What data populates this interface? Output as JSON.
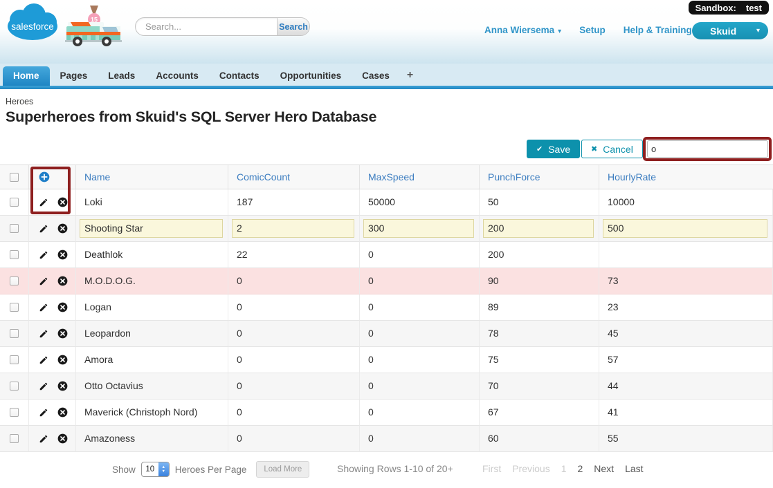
{
  "sandbox": {
    "label": "Sandbox:",
    "value": "test"
  },
  "header": {
    "logo_text": "salesforce",
    "search": {
      "placeholder": "Search...",
      "button": "Search"
    },
    "user": "Anna Wiersema",
    "links": {
      "setup": "Setup",
      "help": "Help & Training"
    },
    "skuid_button": "Skuid"
  },
  "tabs": {
    "items": [
      "Home",
      "Pages",
      "Leads",
      "Accounts",
      "Contacts",
      "Opportunities",
      "Cases",
      "+"
    ],
    "active": "Home"
  },
  "page": {
    "breadcrumb": "Heroes",
    "title": "Superheroes from Skuid's SQL Server Hero Database"
  },
  "toolbar": {
    "save_label": "Save",
    "cancel_label": "Cancel",
    "filter_value": "o"
  },
  "icons": {
    "save_check": "✔",
    "cancel_x": "✖",
    "dropdown_caret": "▾",
    "select_up": "▲",
    "select_down": "▼"
  },
  "colors": {
    "accent_teal": "#0d91ac",
    "link_blue": "#3c7dc0",
    "annotation_red": "#8e1f1f",
    "edit_cell_bg": "#faf7dc",
    "deleted_row_bg": "#fbe1e1",
    "active_tab_blue": "#1f86c4"
  },
  "table": {
    "columns": [
      "Name",
      "ComicCount",
      "MaxSpeed",
      "PunchForce",
      "HourlyRate"
    ],
    "rows": [
      {
        "values": [
          "Loki",
          "187",
          "50000",
          "50",
          "10000"
        ],
        "state": "normal"
      },
      {
        "values": [
          "Shooting Star",
          "2",
          "300",
          "200",
          "500"
        ],
        "state": "editing"
      },
      {
        "values": [
          "Deathlok",
          "22",
          "0",
          "200",
          ""
        ],
        "state": "normal"
      },
      {
        "values": [
          "M.O.D.O.G.",
          "0",
          "0",
          "90",
          "73"
        ],
        "state": "deleted"
      },
      {
        "values": [
          "Logan",
          "0",
          "0",
          "89",
          "23"
        ],
        "state": "normal"
      },
      {
        "values": [
          "Leopardon",
          "0",
          "0",
          "78",
          "45"
        ],
        "state": "normal"
      },
      {
        "values": [
          "Amora",
          "0",
          "0",
          "75",
          "57"
        ],
        "state": "normal"
      },
      {
        "values": [
          "Otto Octavius",
          "0",
          "0",
          "70",
          "44"
        ],
        "state": "normal"
      },
      {
        "values": [
          "Maverick (Christoph Nord)",
          "0",
          "0",
          "67",
          "41"
        ],
        "state": "normal"
      },
      {
        "values": [
          "Amazoness",
          "0",
          "0",
          "60",
          "55"
        ],
        "state": "normal"
      }
    ]
  },
  "footer": {
    "show_label": "Show",
    "per_page": "10",
    "per_page_suffix": "Heroes Per Page",
    "load_more": "Load More",
    "status": "Showing Rows 1-10 of 20+",
    "pagination": [
      {
        "label": "First",
        "disabled": true
      },
      {
        "label": "Previous",
        "disabled": true
      },
      {
        "label": "1",
        "disabled": true
      },
      {
        "label": "2",
        "disabled": false
      },
      {
        "label": "Next",
        "disabled": false
      },
      {
        "label": "Last",
        "disabled": false
      }
    ]
  }
}
